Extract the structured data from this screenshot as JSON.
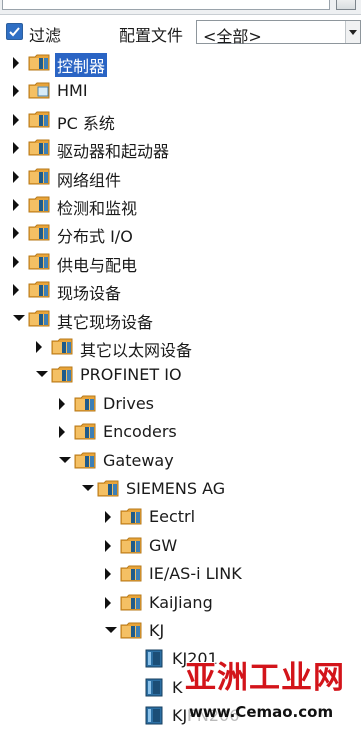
{
  "filter": {
    "checked": true,
    "label": "过滤",
    "profile_label": "配置文件",
    "profile_value": "<全部>"
  },
  "tree": [
    {
      "label": "控制器",
      "level": 0,
      "state": "collapsed",
      "icon": "folder-icon",
      "selected": true
    },
    {
      "label": "HMI",
      "level": 0,
      "state": "collapsed",
      "icon": "folder-hmi-icon"
    },
    {
      "label": "PC 系统",
      "level": 0,
      "state": "collapsed",
      "icon": "folder-icon"
    },
    {
      "label": "驱动器和起动器",
      "level": 0,
      "state": "collapsed",
      "icon": "folder-icon"
    },
    {
      "label": "网络组件",
      "level": 0,
      "state": "collapsed",
      "icon": "folder-icon"
    },
    {
      "label": "检测和监视",
      "level": 0,
      "state": "collapsed",
      "icon": "folder-icon"
    },
    {
      "label": "分布式 I/O",
      "level": 0,
      "state": "collapsed",
      "icon": "folder-icon"
    },
    {
      "label": "供电与配电",
      "level": 0,
      "state": "collapsed",
      "icon": "folder-icon"
    },
    {
      "label": "现场设备",
      "level": 0,
      "state": "collapsed",
      "icon": "folder-icon"
    },
    {
      "label": "其它现场设备",
      "level": 0,
      "state": "expanded",
      "icon": "folder-icon"
    },
    {
      "label": "其它以太网设备",
      "level": 1,
      "state": "collapsed",
      "icon": "folder-icon"
    },
    {
      "label": "PROFINET IO",
      "level": 1,
      "state": "expanded",
      "icon": "folder-icon"
    },
    {
      "label": "Drives",
      "level": 2,
      "state": "collapsed",
      "icon": "folder-icon"
    },
    {
      "label": "Encoders",
      "level": 2,
      "state": "collapsed",
      "icon": "folder-icon"
    },
    {
      "label": "Gateway",
      "level": 2,
      "state": "expanded",
      "icon": "folder-icon"
    },
    {
      "label": "SIEMENS AG",
      "level": 3,
      "state": "expanded",
      "icon": "folder-icon"
    },
    {
      "label": "Eectrl",
      "level": 4,
      "state": "collapsed",
      "icon": "folder-icon"
    },
    {
      "label": "GW",
      "level": 4,
      "state": "collapsed",
      "icon": "folder-icon"
    },
    {
      "label": "IE/AS-i LINK",
      "level": 4,
      "state": "collapsed",
      "icon": "folder-icon"
    },
    {
      "label": "KaiJiang",
      "level": 4,
      "state": "collapsed",
      "icon": "folder-icon"
    },
    {
      "label": "KJ",
      "level": 4,
      "state": "expanded",
      "icon": "folder-icon"
    },
    {
      "label": "KJ201",
      "level": 5,
      "state": "leaf",
      "icon": "device-icon"
    },
    {
      "label": "K",
      "level": 5,
      "state": "leaf",
      "icon": "device-icon"
    },
    {
      "label": "KJPN206",
      "level": 5,
      "state": "leaf",
      "icon": "device-icon"
    }
  ],
  "watermark": {
    "title": "亚洲工业网",
    "url": "www.Cemao.com"
  },
  "colors": {
    "folder": "#e8a43a",
    "folder_dark": "#b77a1a",
    "module": "#1f5b8a",
    "selection": "#2a64c4"
  }
}
